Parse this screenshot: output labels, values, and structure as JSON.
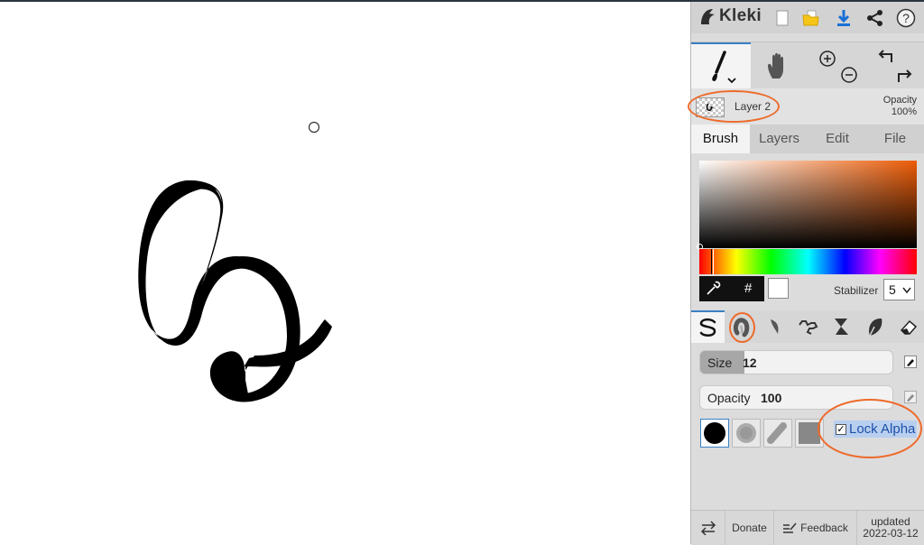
{
  "app": {
    "name": "Kleki"
  },
  "toolbar": {
    "icons": [
      "new-file-icon",
      "open-folder-icon",
      "download-icon",
      "share-icon",
      "help-icon"
    ],
    "accent_color": "#1a6fd6"
  },
  "tools": {
    "icons": [
      "brush-tool-icon",
      "hand-tool-icon",
      "zoom-in-icon",
      "zoom-out-icon",
      "undo-icon",
      "redo-icon"
    ]
  },
  "layer": {
    "name": "Layer 2",
    "opacity_label": "Opacity",
    "opacity_value": "100%"
  },
  "tabs": [
    {
      "label": "Brush",
      "active": true
    },
    {
      "label": "Layers",
      "active": false
    },
    {
      "label": "Edit",
      "active": false
    },
    {
      "label": "File",
      "active": false
    }
  ],
  "color": {
    "primary": "#000000",
    "secondary": "#ffffff",
    "hue_color": "#ec5c07",
    "hex_symbol": "#"
  },
  "stabilizer": {
    "label": "Stabilizer",
    "value": "5"
  },
  "brushes": [
    "pen-brush-icon",
    "blend-brush-icon",
    "sketchy-brush-icon",
    "pixel-brush-icon",
    "chemy-brush-icon",
    "smudge-brush-icon",
    "eraser-icon"
  ],
  "size": {
    "label": "Size",
    "value": "12",
    "fill": 0.23
  },
  "opacity": {
    "label": "Opacity",
    "value": "100",
    "fill": 0
  },
  "lock_alpha": {
    "label": "Lock Alpha",
    "checked": true
  },
  "annotation_color": "#ee6a2a",
  "footer": {
    "donate": "Donate",
    "feedback": "Feedback",
    "updated_label": "updated",
    "updated_date": "2022-03-12"
  }
}
